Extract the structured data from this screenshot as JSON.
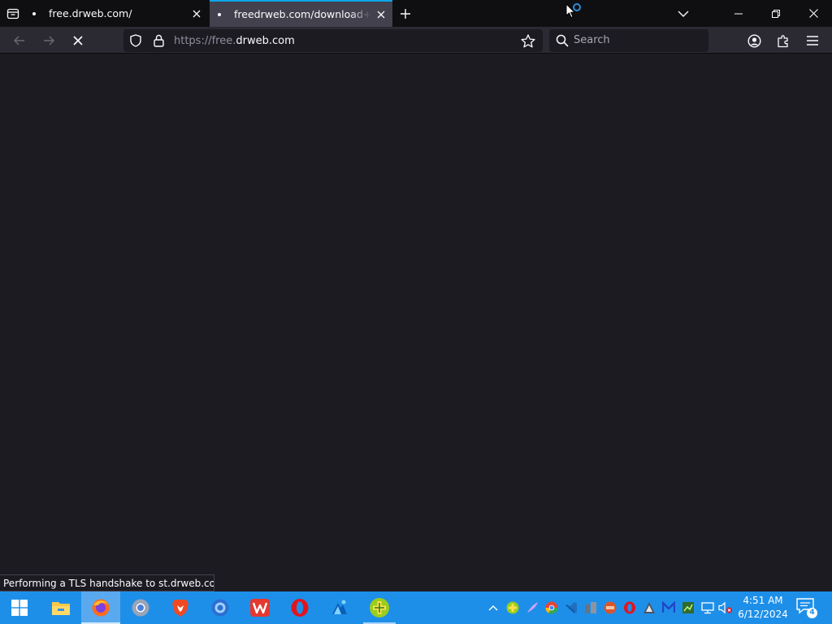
{
  "browser": {
    "tabs": [
      {
        "title": "free.drweb.com/",
        "active": false
      },
      {
        "title": "freedrweb.com/download+cure",
        "active": true
      }
    ],
    "url": {
      "prefix": "https://free.",
      "host": "drweb.com"
    },
    "search": {
      "placeholder": "Search"
    },
    "status_text": "Performing a TLS handshake to st.drweb.com...",
    "colors": {
      "chrome_dark": "#0f0f12",
      "toolbar": "#2b2a33",
      "content": "#1c1b22",
      "accent": "#0ea5e9"
    }
  },
  "taskbar": {
    "apps": [
      {
        "name": "file-explorer",
        "icon": "folder-icon"
      },
      {
        "name": "firefox",
        "icon": "firefox-icon",
        "active": true
      },
      {
        "name": "chrome",
        "icon": "chrome-icon"
      },
      {
        "name": "brave",
        "icon": "brave-icon"
      },
      {
        "name": "browser-blue",
        "icon": "globe-icon"
      },
      {
        "name": "wps-office",
        "icon": "wps-icon"
      },
      {
        "name": "opera",
        "icon": "opera-icon"
      },
      {
        "name": "app-blue",
        "icon": "app-icon"
      },
      {
        "name": "drweb-cureit",
        "icon": "cureit-icon"
      }
    ],
    "clock": {
      "time": "4:51 AM",
      "date": "6/12/2024"
    },
    "notification_count": "4",
    "colors": {
      "taskbar": "#1e8fe8"
    }
  }
}
